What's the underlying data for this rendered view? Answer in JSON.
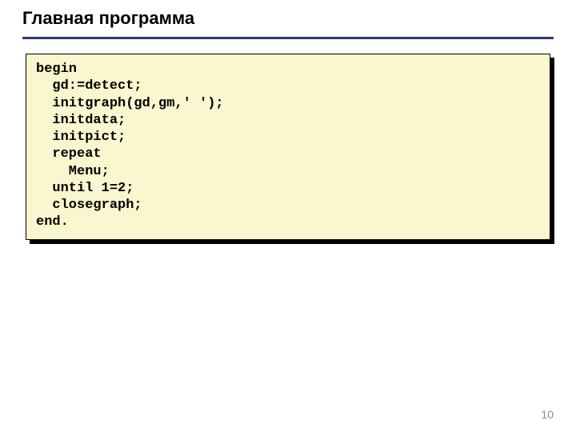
{
  "title": "Главная программа",
  "code": "begin\n  gd:=detect;\n  initgraph(gd,gm,' ');\n  initdata;\n  initpict;\n  repeat\n    Menu;\n  until 1=2;\n  closegraph;\nend.",
  "page_number": "10"
}
